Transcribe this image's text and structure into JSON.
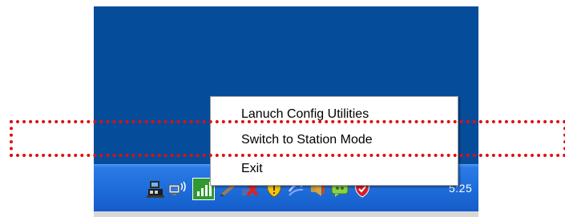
{
  "desktop": {
    "background_color": "#054d9b"
  },
  "context_menu": {
    "items": [
      {
        "label": "Lanuch Config Utilities"
      },
      {
        "label": "Switch to Station Mode"
      },
      {
        "label": "Exit"
      }
    ]
  },
  "taskbar": {
    "clock_text": "5:25",
    "tray_icons": [
      "network-computer-icon",
      "wireless-monitor-icon",
      "signal-strength-icon",
      "pen-icon",
      "red-x-icon",
      "security-shield-icon",
      "arrow-icon",
      "speaker-icon",
      "messenger-icon",
      "antivirus-shield-icon"
    ]
  },
  "annotation": {
    "highlight_color": "#e01010"
  }
}
